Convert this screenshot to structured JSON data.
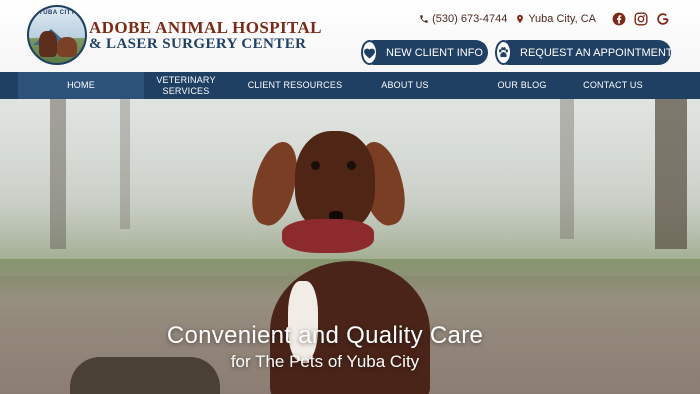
{
  "header": {
    "logo_ring_text": "YUBA CITY",
    "brand_line1": "ADOBE ANIMAL HOSPITAL",
    "brand_line2": "& LASER SURGERY CENTER",
    "phone": "(530) 673-4744",
    "location": "Yuba City, CA",
    "social": [
      "facebook-icon",
      "instagram-icon",
      "google-icon"
    ],
    "cta_new_client": "NEW CLIENT INFO",
    "cta_appointment": "REQUEST AN APPOINTMENT"
  },
  "nav": {
    "items": [
      {
        "label": "HOME"
      },
      {
        "label": "VETERINARY SERVICES"
      },
      {
        "label": "CLIENT RESOURCES"
      },
      {
        "label": "ABOUT US"
      },
      {
        "label": "OUR BLOG"
      },
      {
        "label": "CONTACT US"
      }
    ],
    "active": "HOME"
  },
  "hero": {
    "title": "Convenient and Quality Care",
    "subtitle": "for The Pets of Yuba City"
  },
  "colors": {
    "brand_navy": "#1f3f63",
    "brand_rust": "#7b2a17",
    "nav_active": "#2d5279"
  }
}
